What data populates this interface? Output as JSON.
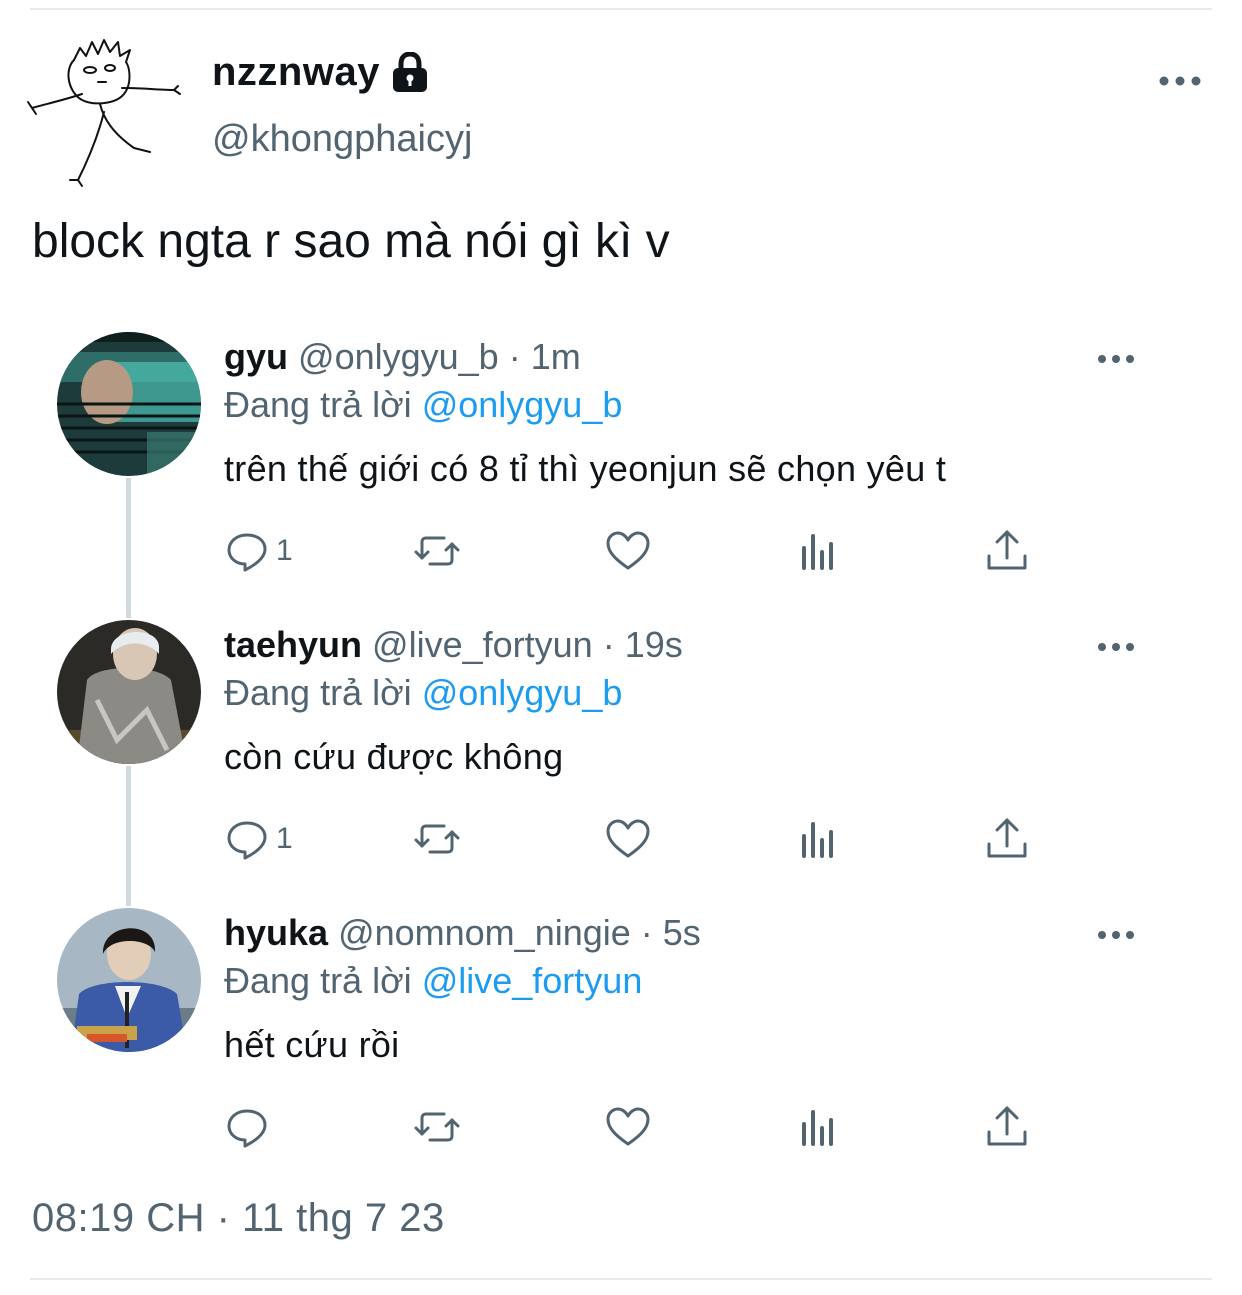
{
  "tweet": {
    "display_name": "nzznway",
    "handle": "@khongphaicyj",
    "text": "block ngta r sao mà nói gì kì v",
    "timestamp": "08:19 CH · 11 thg 7 23",
    "lock_icon": "lock-icon",
    "more_icon": "more-horizontal-icon"
  },
  "replies": [
    {
      "name": "gyu",
      "handle": "@onlygyu_b",
      "time": "· 1m",
      "replying_label": "Đang trả lời",
      "replying_to": "@onlygyu_b",
      "text": "trên thế giới có 8 tỉ thì yeonjun sẽ chọn yêu t",
      "reply_count": "1",
      "avatar_colors": [
        "#1d3b3a",
        "#4fc0b4"
      ]
    },
    {
      "name": "taehyun",
      "handle": "@live_fortyun",
      "time": "· 19s",
      "replying_label": "Đang trả lời",
      "replying_to": "@onlygyu_b",
      "text": "còn cứu được không",
      "reply_count": "1",
      "avatar_colors": [
        "#2b2a27",
        "#8c8a85"
      ]
    },
    {
      "name": "hyuka",
      "handle": "@nomnom_ningie",
      "time": "· 5s",
      "replying_label": "Đang trả lời",
      "replying_to": "@live_fortyun",
      "text": "hết cứu rồi",
      "reply_count": "",
      "avatar_colors": [
        "#a7b8c4",
        "#3b5aa8"
      ]
    }
  ],
  "colors": {
    "link": "#1d9bf0",
    "secondary_text": "#536471",
    "thread_line": "#cfd9de"
  }
}
